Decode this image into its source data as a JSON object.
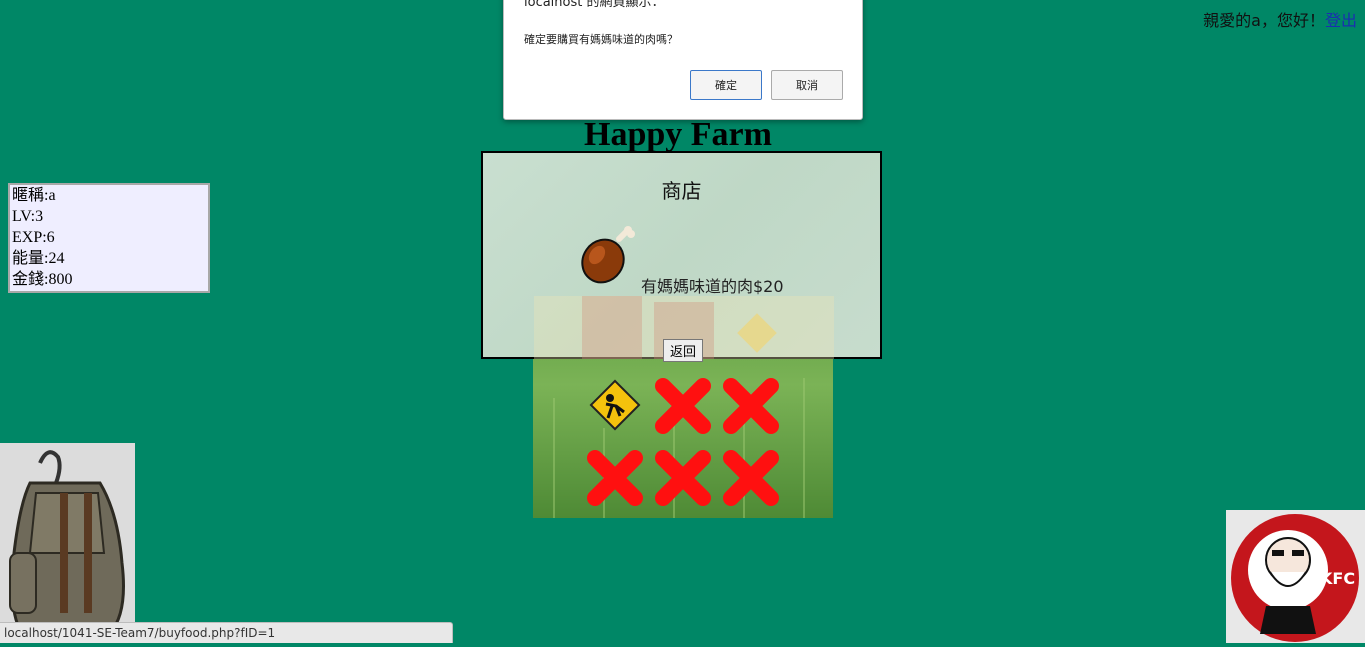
{
  "header": {
    "greeting": "親愛的a，您好！",
    "logout_label": "登出",
    "title": "Happy Farm"
  },
  "stats": {
    "nickname": "暱稱:a",
    "level": "LV:3",
    "exp": "EXP:6",
    "energy": "能量:24",
    "money": "金錢:800"
  },
  "shop": {
    "title": "商店",
    "item_label": "有媽媽味道的肉$20",
    "item_icon": "meat-drumstick-icon",
    "back_label": "返回"
  },
  "farm": {
    "plots": [
      "construction-sign-icon",
      "cross-icon",
      "cross-icon",
      "cross-icon",
      "cross-icon",
      "cross-icon"
    ]
  },
  "dialog": {
    "title": "localhost 的網頁顯示：",
    "message": "確定要購買有媽媽味道的肉嗎？",
    "ok_label": "確定",
    "cancel_label": "取消"
  },
  "statusbar": {
    "url": "localhost/1041-SE-Team7/buyfood.php?fID=1"
  },
  "colors": {
    "background": "#008766",
    "cross": "#ff0000",
    "link": "#1a2fb0"
  }
}
